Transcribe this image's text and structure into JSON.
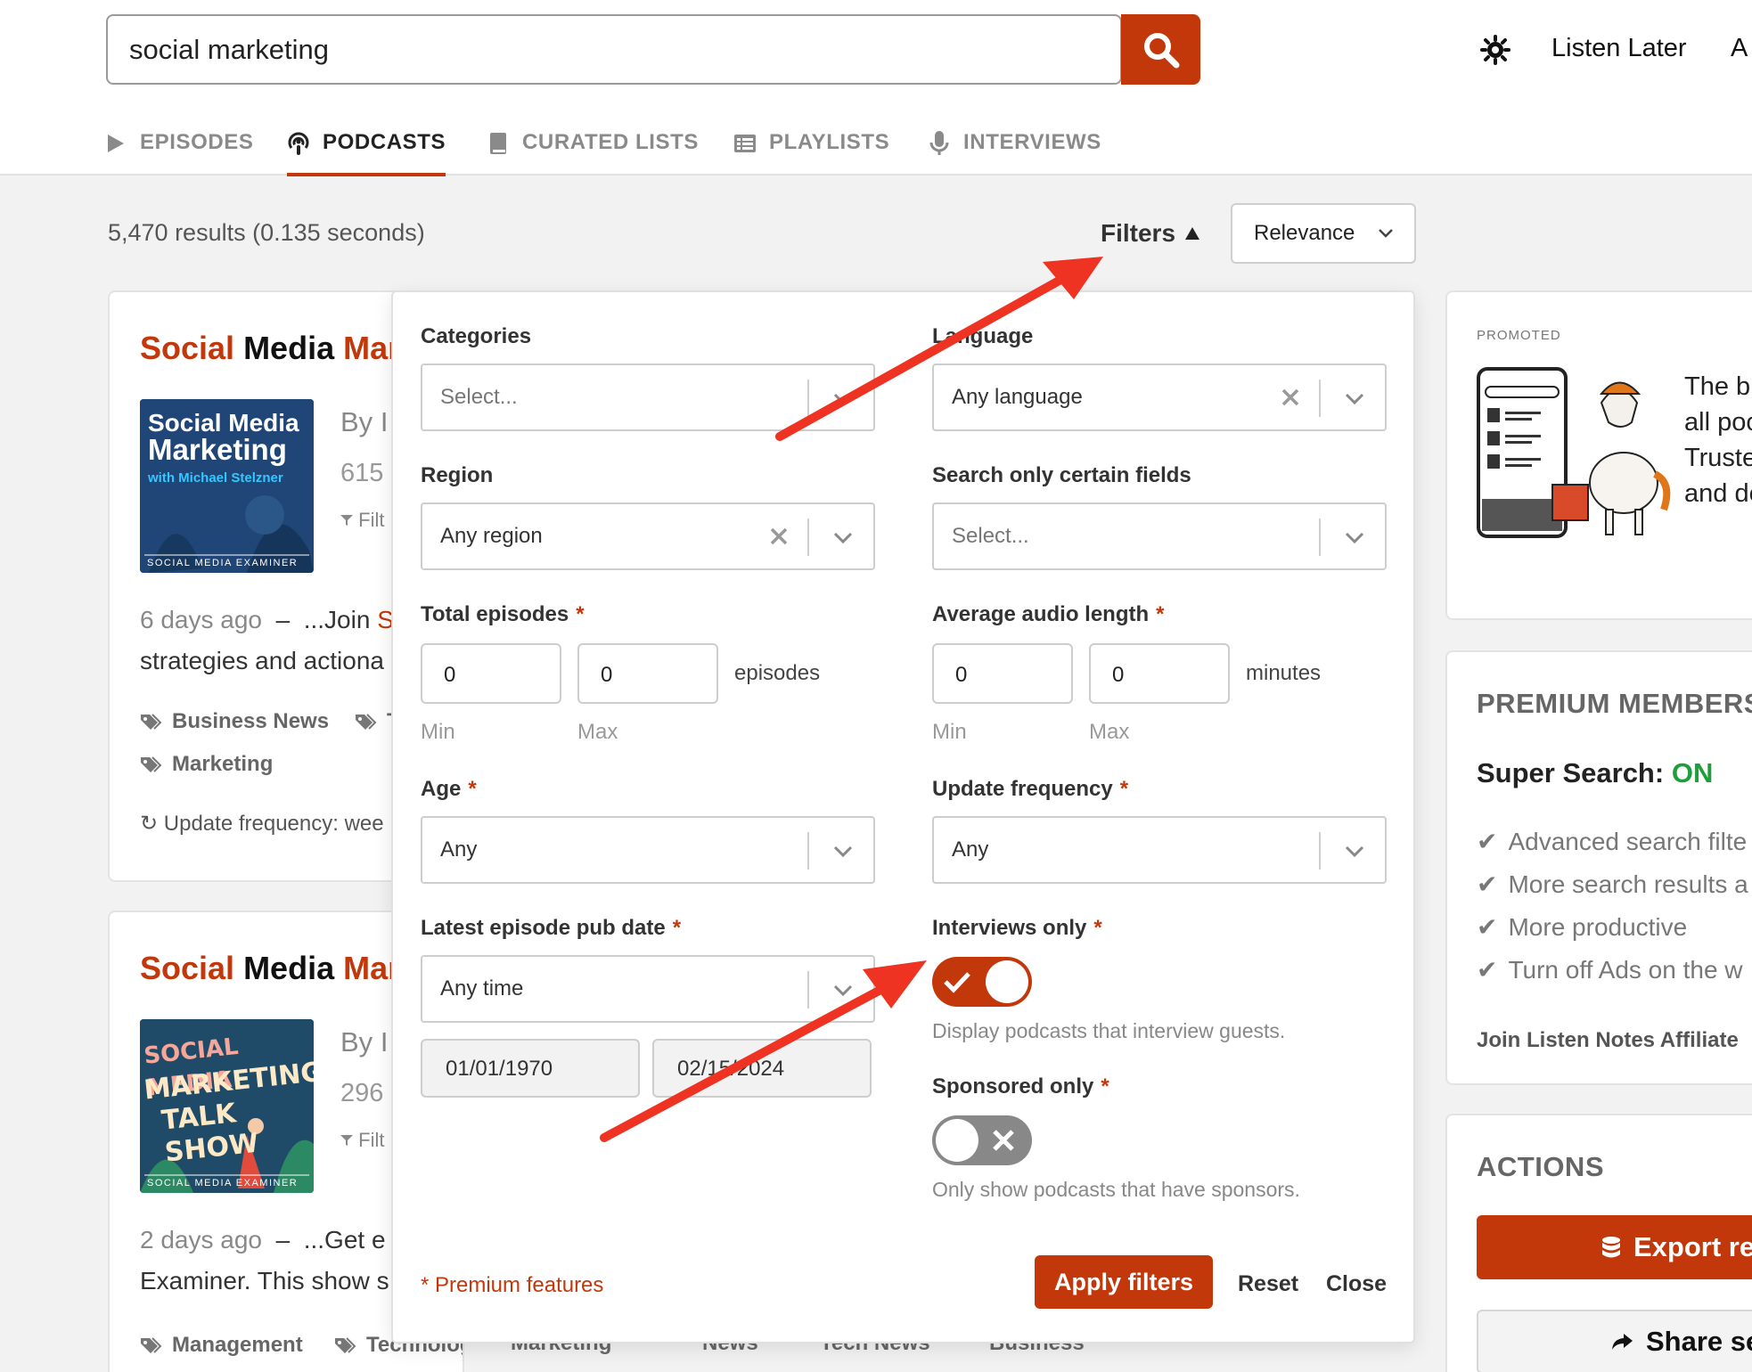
{
  "search": {
    "value": "social marketing"
  },
  "header": {
    "listen_later": "Listen Later",
    "overflow_letter": "A"
  },
  "tabs": [
    {
      "label": "EPISODES",
      "icon": "play-icon"
    },
    {
      "label": "PODCASTS",
      "icon": "podcast-icon",
      "active": true
    },
    {
      "label": "CURATED LISTS",
      "icon": "book-icon"
    },
    {
      "label": "PLAYLISTS",
      "icon": "list-icon"
    },
    {
      "label": "INTERVIEWS",
      "icon": "microphone-icon"
    }
  ],
  "results": {
    "count_text": "5,470 results (0.135 seconds)",
    "filters_label": "Filters",
    "sort_value": "Relevance"
  },
  "cards": [
    {
      "title_hl1": "Social",
      "title_mid": " Media ",
      "title_hl2": "Mar",
      "cover_lines": [
        "Social Media",
        "Marketing"
      ],
      "cover_sub": "with Michael Stelzner",
      "cover_foot": "SOCIAL MEDIA EXAMINER",
      "by": "By",
      "by_tail": "I",
      "count": "615",
      "filter": "Filt",
      "snippet_age": "6 days ago",
      "snippet_dash": "–",
      "snippet_start": "...Join",
      "snippet_red": "S",
      "snippet_line2": "strategies and actiona",
      "tags": [
        "Business News",
        "T",
        "Marketing"
      ],
      "update": "Update frequency: wee"
    },
    {
      "title_hl1": "Social",
      "title_mid": " Media ",
      "title_hl2": "Mar",
      "cover_lines": [
        "SOCIAL MEDIA",
        "MARKETING",
        "TALK SHOW"
      ],
      "cover_foot": "SOCIAL MEDIA EXAMINER",
      "by": "By",
      "by_tail": "I",
      "count": "296",
      "filter": "Filt",
      "snippet_age": "2 days ago",
      "snippet_dash": "–",
      "snippet_start": "...Get e",
      "snippet_line2": "Examiner. This show s",
      "tags": [
        "Management",
        "Technology",
        "Marketing",
        "News",
        "Tech News",
        "Business"
      ]
    }
  ],
  "filters": {
    "categories": {
      "label": "Categories",
      "placeholder": "Select..."
    },
    "language": {
      "label": "Language",
      "value": "Any language"
    },
    "region": {
      "label": "Region",
      "value": "Any region"
    },
    "fields": {
      "label": "Search only certain fields",
      "placeholder": "Select..."
    },
    "total_episodes": {
      "label": "Total episodes",
      "required": "*",
      "min": "0",
      "max": "0",
      "unit": "episodes",
      "min_label": "Min",
      "max_label": "Max"
    },
    "audio_length": {
      "label": "Average audio length",
      "required": "*",
      "min": "0",
      "max": "0",
      "unit": "minutes",
      "min_label": "Min",
      "max_label": "Max"
    },
    "age": {
      "label": "Age",
      "required": "*",
      "value": "Any"
    },
    "update_frequency": {
      "label": "Update frequency",
      "required": "*",
      "value": "Any"
    },
    "pub_date": {
      "label": "Latest episode pub date",
      "required": "*",
      "value": "Any time",
      "from": "01/01/1970",
      "to": "02/15/2024"
    },
    "interviews_only": {
      "label": "Interviews only",
      "required": "*",
      "on": true,
      "help": "Display podcasts that interview guests."
    },
    "sponsored_only": {
      "label": "Sponsored only",
      "required": "*",
      "on": false,
      "help": "Only show podcasts that have sponsors."
    },
    "premium_note": "* Premium features",
    "apply": "Apply filters",
    "reset": "Reset",
    "close": "Close"
  },
  "sidebar": {
    "promo_label": "PROMOTED",
    "promo_lines": [
      "The b",
      "all poc",
      "Truste",
      "and de"
    ],
    "premium_heading": "PREMIUM MEMBERS",
    "super_search": "Super Search:",
    "super_on": "ON",
    "benefits": [
      "Advanced search filte",
      "More search results a",
      "More productive",
      "Turn off Ads on the w"
    ],
    "affiliate": "Join Listen Notes Affiliate",
    "actions_heading": "ACTIONS",
    "export": "Export re",
    "share": "Share se"
  },
  "colors": {
    "accent": "#c3380a",
    "on_green": "#1f9e3c",
    "annotation_arrow": "#ee3322"
  }
}
